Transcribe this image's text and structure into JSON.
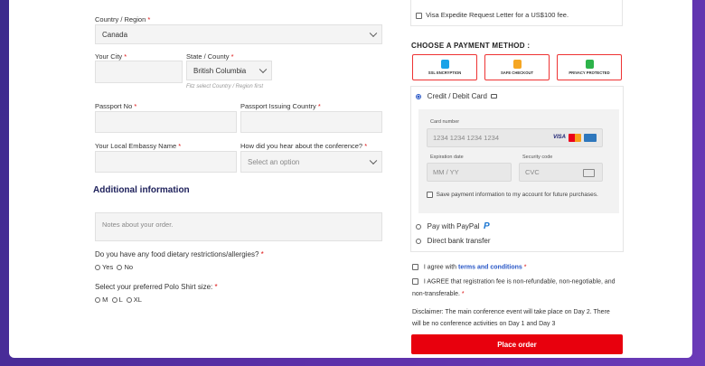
{
  "billing": {
    "country_label": "Country / Region",
    "country_value": "Canada",
    "city_label": "Your City",
    "state_label": "State / County",
    "state_value": "British Columbia",
    "state_hint": "Fitz select Country / Region first",
    "passport_label": "Passport No",
    "passport_country_label": "Passport Issuing Country",
    "embassy_label": "Your Local Embassy Name",
    "hear_label": "How did you hear about the conference?",
    "hear_placeholder": "Select an option",
    "required_mark": "*"
  },
  "additional": {
    "heading": "Additional information",
    "notes_placeholder": "Notes about your order.",
    "diet_question": "Do you have any food dietary restrictions/allergies?",
    "diet_options": [
      "Yes",
      "No"
    ],
    "shirt_question": "Select your preferred Polo Shirt size:",
    "shirt_options": [
      "M",
      "L",
      "XL"
    ]
  },
  "order": {
    "visa_letter": "Visa Expedite Request Letter for a US$100 fee.",
    "payment_heading": "CHOOSE A PAYMENT METHOD :",
    "badges": [
      {
        "text": "SSL ENCRYPTION",
        "color": "#1aa3e8"
      },
      {
        "text": "SAFE CHECKOUT",
        "color": "#f5a623"
      },
      {
        "text": "PRIVACY PROTECTED",
        "color": "#2db34a"
      }
    ],
    "card_method": "Credit / Debit Card",
    "card_number_label": "Card number",
    "card_number_placeholder": "1234 1234 1234 1234",
    "card_brands": [
      "VISA",
      "MC",
      "AMEX"
    ],
    "expiry_label": "Expiration date",
    "expiry_placeholder": "MM / YY",
    "cvc_label": "Security code",
    "cvc_placeholder": "CVC",
    "save_card": "Save payment information to my account for future purchases.",
    "paypal": "Pay with PayPal",
    "bank": "Direct bank transfer",
    "agree_prefix": "I agree with",
    "terms_link": "terms and conditions",
    "agree_fee": "I AGREE that registration fee is non-refundable, non-negotiable, and",
    "agree_fee2": "non-transferable.",
    "disclaimer1": "Disclaimer: The main conference event will take place on Day 2. There",
    "disclaimer2": "will be no conference activities on Day 1 and Day 3",
    "place_order": "Place order"
  }
}
